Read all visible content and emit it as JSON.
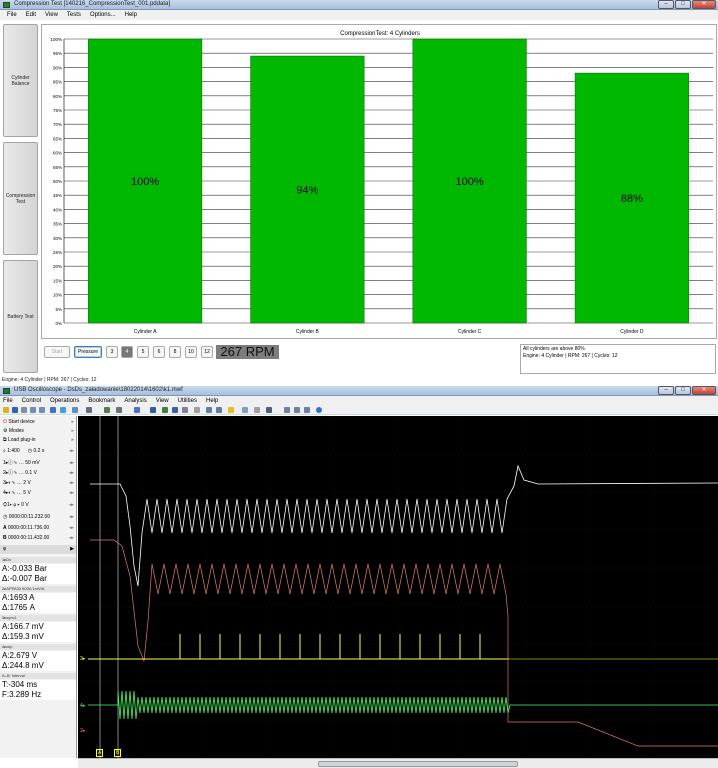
{
  "top_window": {
    "title": "Compression Test [140216_CompressionTest_001.pddata]",
    "menu": [
      "File",
      "Edit",
      "View",
      "Tests",
      "Options...",
      "Help"
    ],
    "side_buttons": [
      "Cylinder\nBalance",
      "Compression\nTest",
      "Battery Test"
    ],
    "controls": {
      "start_label": "Start",
      "pressure_label": "Pressure",
      "cycle_options": [
        "3",
        "4",
        "5",
        "6",
        "8",
        "10",
        "12"
      ],
      "selected_cycles": "4"
    },
    "rpm_display": "267 RPM",
    "info_lines": [
      "All cylinders are above 80%",
      "Engine: 4 Cylinder | RPM: 267 | Cycles: 12"
    ],
    "status_text": "Engine: 4 Cylinder | RPM: 267 | Cycles: 12"
  },
  "chart_data": {
    "type": "bar",
    "title": "CompressionTest: 4 Cylinders",
    "categories": [
      "Cylinder A",
      "Cylinder B",
      "Cylinder C",
      "Cylinder D"
    ],
    "values": [
      100,
      94,
      100,
      88
    ],
    "data_labels": [
      "100%",
      "94%",
      "100%",
      "88%"
    ],
    "y_ticks": [
      "100%",
      "95%",
      "90%",
      "85%",
      "80%",
      "75%",
      "70%",
      "65%",
      "60%",
      "55%",
      "50%",
      "45%",
      "40%",
      "35%",
      "30%",
      "25%",
      "20%",
      "15%",
      "10%",
      "5%",
      "0%"
    ],
    "ylim": [
      0,
      100
    ],
    "grid": true,
    "bar_color": "#00b800"
  },
  "bottom_window": {
    "title": "USB Oscilloscope - DsDs_załadowanie\\18022014\\1602\\k1.mwf",
    "menu": [
      "File",
      "Control",
      "Operations",
      "Bookmark",
      "Analysis",
      "View",
      "Utilities",
      "Help"
    ],
    "panel": {
      "start_device": "Start device",
      "modes": "Modes",
      "load_plugin": "Load plug-in",
      "timebase": "1:400",
      "time_div": "0.2 s",
      "channels": [
        {
          "id": "1",
          "value": "50 mV"
        },
        {
          "id": "2",
          "value": "0.1 V"
        },
        {
          "id": "3",
          "value": "2 V"
        },
        {
          "id": "4",
          "value": "5 V"
        }
      ],
      "trigger": "0 V",
      "time_cursor": "0000:00:11.232.00",
      "cursor_a": "0000:00:11.736.00",
      "cursor_b": "0000:00:11.432.00",
      "phi": "φ",
      "measurements": [
        {
          "header": "1▸Dx",
          "a": "A:-0.033 Bar",
          "d": "Δ:-0.007 Bar"
        },
        {
          "header": "2▸APPA32 600A 1mV/A",
          "a": "A:1693 A",
          "d": "Δ:1765 A"
        },
        {
          "header": "3▸sync1",
          "a": "A:166.7 mV",
          "d": "Δ:159.3 mV"
        },
        {
          "header": "4▸ckp",
          "a": "A:2.679 V",
          "d": "Δ:244.8 mV"
        },
        {
          "header": "A–B: interval",
          "a": "T:-304 ms",
          "d": "F:3.289 Hz"
        }
      ]
    },
    "channel_markers": [
      "3▸",
      "4▸",
      "2▸"
    ],
    "cursor_labels": [
      "A",
      "B"
    ],
    "colors": {
      "ch1": "#ffffff",
      "ch2": "#e07a6a",
      "ch3": "#ffff40",
      "ch4": "#40ff60",
      "grid": "#7a7a00"
    }
  }
}
